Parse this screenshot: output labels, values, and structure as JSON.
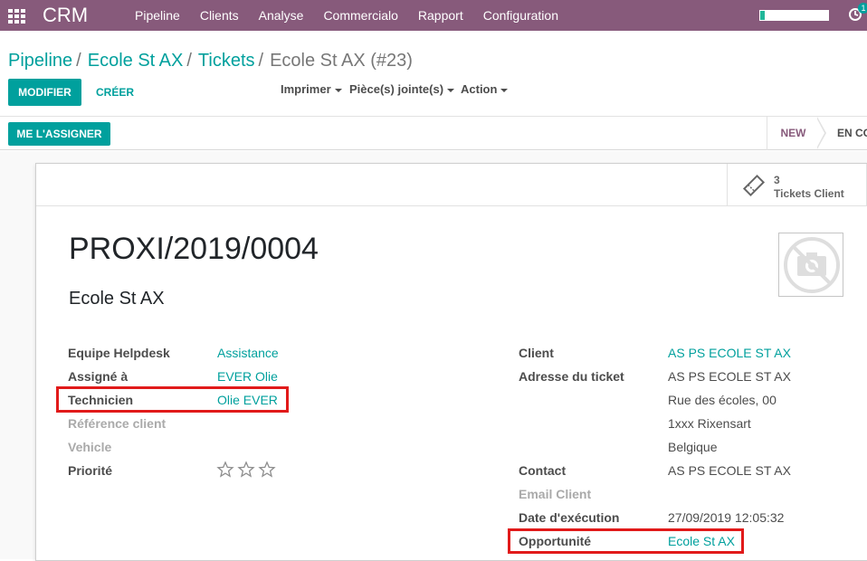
{
  "navbar": {
    "brand": "CRM",
    "menu": [
      "Pipeline",
      "Clients",
      "Analyse",
      "Commercialo",
      "Rapport",
      "Configuration"
    ],
    "activity_count": "1"
  },
  "breadcrumb": {
    "items": [
      "Pipeline",
      "Ecole St AX",
      "Tickets"
    ],
    "current": "Ecole St AX (#23)"
  },
  "toolbar": {
    "edit_label": "MODIFIER",
    "create_label": "CRÉER",
    "print_label": "Imprimer",
    "attachments_label": "Pièce(s) jointe(s)",
    "action_label": "Action"
  },
  "statusbar": {
    "assign_label": "ME L'ASSIGNER",
    "stages": [
      "NEW",
      "EN CO"
    ]
  },
  "smart_button": {
    "count": "3",
    "label": "Tickets Client"
  },
  "record": {
    "name": "PROXI/2019/0004",
    "partner": "Ecole St AX"
  },
  "left_fields": [
    {
      "label": "Equipe Helpdesk",
      "value": "Assistance"
    },
    {
      "label": "Assigné à",
      "value": "EVER Olie"
    },
    {
      "label": "Technicien",
      "value": "Olie EVER"
    },
    {
      "label": "Référence client",
      "value": ""
    },
    {
      "label": "Vehicle",
      "value": ""
    },
    {
      "label": "Priorité",
      "value": ""
    }
  ],
  "right_fields": {
    "client_label": "Client",
    "client_value": "AS PS ECOLE ST AX",
    "address_label": "Adresse du ticket",
    "address_lines": [
      "AS PS ECOLE ST AX",
      "Rue des écoles, 00",
      "1xxx Rixensart",
      "Belgique"
    ],
    "contact_label": "Contact",
    "contact_value": "AS PS ECOLE ST AX",
    "email_label": "Email Client",
    "email_value": "",
    "date_label": "Date d'exécution",
    "date_value": "27/09/2019 12:05:32",
    "opportunity_label": "Opportunité",
    "opportunity_value": "Ecole St AX"
  },
  "priority_stars": 0,
  "colors": {
    "navbar": "#875a7b",
    "primary": "#00a09d",
    "highlight": "#e11a1a"
  }
}
